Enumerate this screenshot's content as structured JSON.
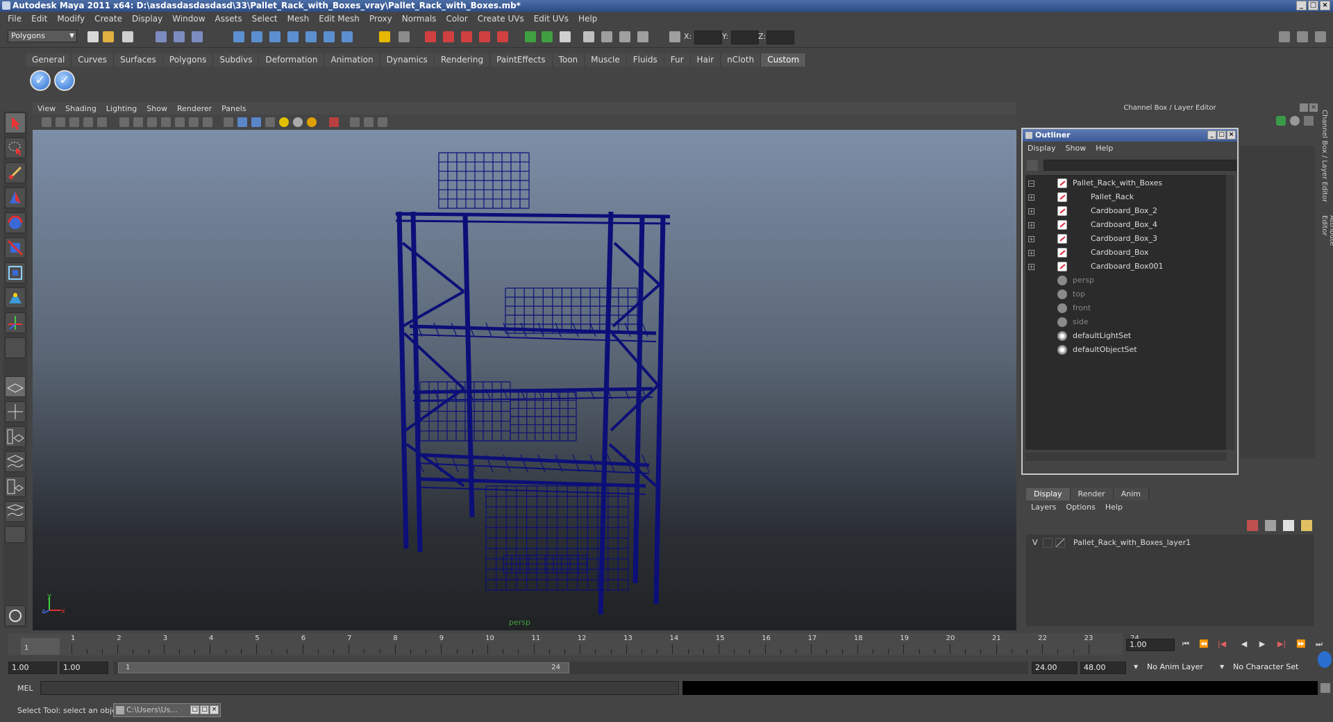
{
  "window": {
    "title": "Autodesk Maya 2011 x64: D:\\asdasdasdasdasd\\33\\Pallet_Rack_with_Boxes_vray\\Pallet_Rack_with_Boxes.mb*"
  },
  "menubar": [
    "File",
    "Edit",
    "Modify",
    "Create",
    "Display",
    "Window",
    "Assets",
    "Select",
    "Mesh",
    "Edit Mesh",
    "Proxy",
    "Normals",
    "Color",
    "Create UVs",
    "Edit UVs",
    "Help"
  ],
  "statusline": {
    "mode": "Polygons",
    "x_label": "X:",
    "y_label": "Y:",
    "z_label": "Z:"
  },
  "shelf_tabs": [
    "General",
    "Curves",
    "Surfaces",
    "Polygons",
    "Subdivs",
    "Deformation",
    "Animation",
    "Dynamics",
    "Rendering",
    "PaintEffects",
    "Toon",
    "Muscle",
    "Fluids",
    "Fur",
    "Hair",
    "nCloth",
    "Custom"
  ],
  "shelf_active": "Custom",
  "viewport": {
    "menu": [
      "View",
      "Shading",
      "Lighting",
      "Show",
      "Renderer",
      "Panels"
    ],
    "camera_label": "persp",
    "wire_color": "#0c0f78"
  },
  "channel_box": {
    "header": "Channel Box / Layer Editor",
    "side_tabs": [
      "Channel Box / Layer Editor",
      "Attribute Editor"
    ]
  },
  "outliner": {
    "title": "Outliner",
    "menu": [
      "Display",
      "Show",
      "Help"
    ],
    "items": [
      {
        "label": "Pallet_Rack_with_Boxes",
        "icon": "mesh-icon",
        "expand": "−",
        "child": false,
        "dim": false
      },
      {
        "label": "Pallet_Rack",
        "icon": "mesh-icon",
        "expand": "+",
        "child": true,
        "dim": false
      },
      {
        "label": "Cardboard_Box_2",
        "icon": "mesh-icon",
        "expand": "+",
        "child": true,
        "dim": false
      },
      {
        "label": "Cardboard_Box_4",
        "icon": "mesh-icon",
        "expand": "+",
        "child": true,
        "dim": false
      },
      {
        "label": "Cardboard_Box_3",
        "icon": "mesh-icon",
        "expand": "+",
        "child": true,
        "dim": false
      },
      {
        "label": "Cardboard_Box",
        "icon": "mesh-icon",
        "expand": "+",
        "child": true,
        "dim": false
      },
      {
        "label": "Cardboard_Box001",
        "icon": "mesh-icon",
        "expand": "+",
        "child": true,
        "dim": false
      },
      {
        "label": "persp",
        "icon": "camera-icon",
        "expand": "",
        "child": false,
        "dim": true
      },
      {
        "label": "top",
        "icon": "camera-icon",
        "expand": "",
        "child": false,
        "dim": true
      },
      {
        "label": "front",
        "icon": "camera-icon",
        "expand": "",
        "child": false,
        "dim": true
      },
      {
        "label": "side",
        "icon": "camera-icon",
        "expand": "",
        "child": false,
        "dim": true
      },
      {
        "label": "defaultLightSet",
        "icon": "set-icon",
        "expand": "",
        "child": false,
        "dim": false
      },
      {
        "label": "defaultObjectSet",
        "icon": "set-icon",
        "expand": "",
        "child": false,
        "dim": false
      }
    ]
  },
  "layer_editor": {
    "tabs": [
      "Display",
      "Render",
      "Anim"
    ],
    "active_tab": "Display",
    "menu": [
      "Layers",
      "Options",
      "Help"
    ],
    "layers": [
      {
        "visible": "V",
        "name": "Pallet_Rack_with_Boxes_layer1"
      }
    ]
  },
  "timeline": {
    "ticks": [
      "1",
      "2",
      "3",
      "4",
      "5",
      "6",
      "7",
      "8",
      "9",
      "10",
      "11",
      "12",
      "13",
      "14",
      "15",
      "16",
      "17",
      "18",
      "19",
      "20",
      "21",
      "22",
      "23",
      "24"
    ],
    "current_frame_marker": "1",
    "current_time": "1.00"
  },
  "range": {
    "start": "1.00",
    "inner_start": "1.00",
    "slider_start": "1",
    "slider_end": "24",
    "inner_end": "24.00",
    "end": "48.00",
    "anim_layer": "No Anim Layer",
    "character_set": "No Character Set"
  },
  "command_line": {
    "label": "MEL"
  },
  "help_line": {
    "text": "Select Tool: select an object"
  },
  "taskbar": {
    "item": "C:\\Users\\Us..."
  }
}
